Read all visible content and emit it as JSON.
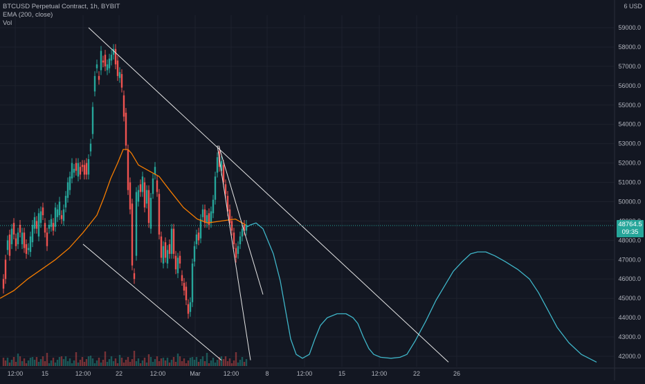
{
  "header": {
    "symbol": "BTCUSD Perpetual Contract, 1h, BYBIT",
    "indicator": "EMA (200, close)",
    "volume_label": "Vol"
  },
  "axis_currency": {
    "count": "6",
    "currency": "USD"
  },
  "last_price": {
    "value": "48764.5",
    "countdown": "09:35"
  },
  "colors": {
    "background": "#131722",
    "grid": "#1e222d",
    "text": "#b2b5be",
    "up_candle": "#26a69a",
    "down_candle": "#ef5350",
    "ema": "#f57c00",
    "projection": "#3fb6c9",
    "trendline": "#e6e6e6",
    "last_price": "#26a69a"
  },
  "chart_data": {
    "type": "line",
    "title": "BTCUSD Perpetual Contract, 1h, BYBIT",
    "price_axis": {
      "ticks": [
        "42000.0",
        "43000.0",
        "44000.0",
        "45000.0",
        "46000.0",
        "47000.0",
        "48000.0",
        "49000.0",
        "50000.0",
        "51000.0",
        "52000.0",
        "53000.0",
        "54000.0",
        "55000.0",
        "56000.0",
        "57000.0",
        "58000.0",
        "59000.0"
      ],
      "range": [
        41600,
        59600
      ]
    },
    "time_axis": {
      "ticks": [
        "12:00",
        "15",
        "12:00",
        "22",
        "12:00",
        "Mar",
        "12:00",
        "8",
        "12:00",
        "15",
        "12:00",
        "22",
        "26"
      ]
    },
    "series": [
      {
        "name": "EMA (200, close)",
        "kind": "ema",
        "points": [
          [
            0,
            45000
          ],
          [
            20,
            45400
          ],
          [
            40,
            46000
          ],
          [
            60,
            46500
          ],
          [
            80,
            47000
          ],
          [
            100,
            47600
          ],
          [
            120,
            48400
          ],
          [
            140,
            49300
          ],
          [
            150,
            50200
          ],
          [
            160,
            51200
          ],
          [
            170,
            52000
          ],
          [
            178,
            52700
          ],
          [
            185,
            52700
          ],
          [
            190,
            52500
          ],
          [
            200,
            51900
          ],
          [
            215,
            51600
          ],
          [
            230,
            51300
          ],
          [
            245,
            50600
          ],
          [
            265,
            49700
          ],
          [
            285,
            49100
          ],
          [
            300,
            48900
          ],
          [
            320,
            49000
          ],
          [
            340,
            49100
          ],
          [
            355,
            48800
          ]
        ]
      },
      {
        "kind": "projection",
        "points": [
          [
            357,
            48700
          ],
          [
            362,
            48800
          ],
          [
            370,
            48900
          ],
          [
            380,
            48600
          ],
          [
            395,
            47300
          ],
          [
            405,
            45900
          ],
          [
            413,
            44300
          ],
          [
            420,
            42900
          ],
          [
            428,
            42100
          ],
          [
            437,
            41900
          ],
          [
            447,
            42100
          ],
          [
            455,
            42900
          ],
          [
            463,
            43600
          ],
          [
            473,
            44000
          ],
          [
            487,
            44200
          ],
          [
            500,
            44200
          ],
          [
            510,
            44000
          ],
          [
            517,
            43700
          ],
          [
            525,
            43000
          ],
          [
            533,
            42400
          ],
          [
            540,
            42100
          ],
          [
            550,
            41950
          ],
          [
            565,
            41900
          ],
          [
            578,
            41950
          ],
          [
            588,
            42100
          ],
          [
            600,
            42800
          ],
          [
            615,
            43800
          ],
          [
            630,
            44900
          ],
          [
            645,
            45800
          ],
          [
            655,
            46400
          ],
          [
            668,
            46900
          ],
          [
            680,
            47300
          ],
          [
            690,
            47400
          ],
          [
            702,
            47400
          ],
          [
            715,
            47200
          ],
          [
            730,
            46900
          ],
          [
            748,
            46500
          ],
          [
            765,
            46000
          ],
          [
            778,
            45300
          ],
          [
            790,
            44500
          ],
          [
            805,
            43500
          ],
          [
            822,
            42700
          ],
          [
            840,
            42100
          ],
          [
            862,
            41700
          ]
        ]
      }
    ],
    "trendlines": [
      {
        "from": [
          128,
          59000
        ],
        "to": [
          648,
          41700
        ]
      },
      {
        "from": [
          120,
          47800
        ],
        "to": [
          320,
          41800
        ]
      },
      {
        "from": [
          314,
          52900
        ],
        "to": [
          362,
          41800
        ]
      },
      {
        "from": [
          316,
          52900
        ],
        "to": [
          380,
          45200
        ]
      }
    ],
    "candles": {
      "points": [
        [
          5,
          46000,
          45500
        ],
        [
          8,
          47000,
          46000
        ],
        [
          11,
          47500,
          48000
        ],
        [
          14,
          48300,
          47200
        ],
        [
          17,
          47800,
          48600
        ],
        [
          20,
          48900,
          48300
        ],
        [
          23,
          48100,
          47700
        ],
        [
          26,
          47800,
          48400
        ],
        [
          29,
          48800,
          48400
        ],
        [
          32,
          47800,
          48400
        ],
        [
          35,
          48400,
          47600
        ],
        [
          38,
          47800,
          47300
        ],
        [
          41,
          47500,
          47600
        ],
        [
          44,
          47400,
          48200
        ],
        [
          47,
          47900,
          48800
        ],
        [
          50,
          48600,
          49200
        ],
        [
          53,
          49000,
          48600
        ],
        [
          56,
          48200,
          49400
        ],
        [
          59,
          48900,
          49500
        ],
        [
          62,
          49700,
          49300
        ],
        [
          65,
          48900,
          48400
        ],
        [
          68,
          48400,
          47700
        ],
        [
          71,
          48600,
          48800
        ],
        [
          74,
          48700,
          49100
        ],
        [
          77,
          48900,
          48500
        ],
        [
          80,
          48700,
          49700
        ],
        [
          83,
          49200,
          49600
        ],
        [
          86,
          49300,
          50000
        ],
        [
          89,
          49300,
          49100
        ],
        [
          92,
          49000,
          49600
        ],
        [
          95,
          49700,
          50300
        ],
        [
          98,
          50200,
          51000
        ],
        [
          101,
          50600,
          51300
        ],
        [
          104,
          51200,
          52000
        ],
        [
          107,
          51500,
          51700
        ],
        [
          110,
          52000,
          51600
        ],
        [
          113,
          51300,
          52000
        ],
        [
          116,
          51800,
          51400
        ],
        [
          119,
          51900,
          51800
        ],
        [
          122,
          51900,
          51400
        ],
        [
          125,
          52000,
          51400
        ],
        [
          128,
          51400,
          52200
        ],
        [
          131,
          52600,
          53000
        ],
        [
          134,
          53500,
          54900
        ],
        [
          137,
          55700,
          56500
        ],
        [
          140,
          56900,
          57100
        ],
        [
          143,
          56500,
          56300
        ],
        [
          146,
          56800,
          57800
        ],
        [
          149,
          57300,
          57200
        ],
        [
          152,
          57600,
          57000
        ],
        [
          155,
          56800,
          57100
        ],
        [
          158,
          56900,
          57400
        ],
        [
          161,
          57300,
          57600
        ],
        [
          164,
          57600,
          57900
        ],
        [
          167,
          57900,
          57100
        ],
        [
          170,
          57300,
          56500
        ],
        [
          173,
          56400,
          56700
        ],
        [
          176,
          56600,
          55900
        ],
        [
          179,
          55500,
          54400
        ],
        [
          182,
          54600,
          52900
        ],
        [
          185,
          52700,
          50600
        ],
        [
          188,
          51000,
          49600
        ],
        [
          191,
          49900,
          46700
        ],
        [
          194,
          46300,
          46000
        ],
        [
          197,
          47200,
          50500
        ],
        [
          200,
          50000,
          50600
        ],
        [
          203,
          50900,
          50500
        ],
        [
          206,
          50500,
          51300
        ],
        [
          209,
          51000,
          49700
        ],
        [
          212,
          49900,
          50600
        ],
        [
          215,
          50600,
          48900
        ],
        [
          218,
          48600,
          50200
        ],
        [
          221,
          50400,
          51200
        ],
        [
          224,
          51400,
          51800
        ],
        [
          227,
          51100,
          50500
        ],
        [
          230,
          50400,
          48300
        ],
        [
          233,
          48200,
          47100
        ],
        [
          236,
          46800,
          47700
        ],
        [
          239,
          47900,
          47100
        ],
        [
          242,
          46800,
          47500
        ],
        [
          245,
          47800,
          47300
        ],
        [
          248,
          47300,
          48600
        ],
        [
          251,
          48600,
          47300
        ],
        [
          254,
          47200,
          46500
        ],
        [
          257,
          46300,
          47100
        ],
        [
          260,
          47200,
          46800
        ],
        [
          263,
          46200,
          45900
        ],
        [
          266,
          45800,
          45400
        ],
        [
          269,
          45600,
          44900
        ],
        [
          272,
          44700,
          44200
        ],
        [
          275,
          44300,
          44800
        ],
        [
          278,
          44800,
          46800
        ],
        [
          281,
          46900,
          47700
        ],
        [
          284,
          47800,
          48300
        ],
        [
          287,
          48400,
          48000
        ],
        [
          290,
          48100,
          49100
        ],
        [
          293,
          49200,
          49600
        ],
        [
          296,
          49600,
          48900
        ],
        [
          299,
          48900,
          49300
        ],
        [
          302,
          49400,
          48800
        ],
        [
          305,
          48900,
          49500
        ],
        [
          308,
          49400,
          50100
        ],
        [
          311,
          50100,
          51300
        ],
        [
          314,
          51500,
          52300
        ],
        [
          317,
          52600,
          51800
        ],
        [
          320,
          51600,
          52100
        ],
        [
          323,
          51900,
          51000
        ],
        [
          326,
          50900,
          50400
        ],
        [
          329,
          50300,
          49500
        ],
        [
          332,
          49600,
          48900
        ],
        [
          335,
          49000,
          48500
        ],
        [
          338,
          48400,
          47800
        ],
        [
          341,
          47600,
          47100
        ],
        [
          344,
          47300,
          47700
        ],
        [
          347,
          47800,
          48200
        ],
        [
          350,
          48200,
          48600
        ],
        [
          353,
          48800,
          48500
        ],
        [
          356,
          48500,
          48800
        ]
      ]
    }
  }
}
